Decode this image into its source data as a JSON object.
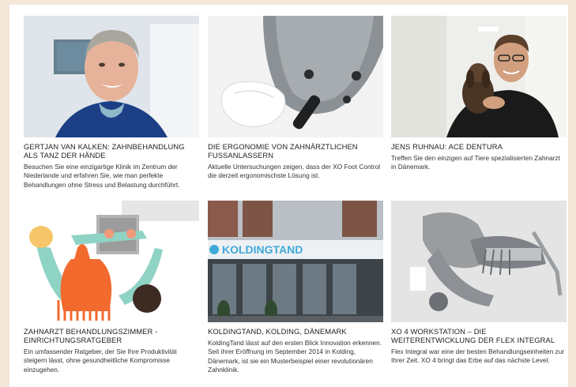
{
  "cards": [
    {
      "title": "GERTJAN VAN KALKEN: ZAHNBEHANDLUNG ALS TANZ DER HÄNDE",
      "desc": "Besuchen Sie eine einzigartige Klinik im Zentrum der Niederlande und erfahren Sie, wie man perfekte Behandlungen ohne Stress und Belastung durchführt.",
      "image": "dentist-portrait-image"
    },
    {
      "title": "DIE ERGONOMIE VON ZAHNÄRZTLICHEN FUSSANLASSERN",
      "desc": "Aktuelle Untersuchungen zeigen, dass der XO Foot Control die derzeit ergonomischste Lösung ist.",
      "image": "foot-control-image"
    },
    {
      "title": "JENS RUHNAU: ACE DENTURA",
      "desc": "Treffen Sie den einzigen auf Tiere spezialisierten Zahnarzt in Dänemark.",
      "image": "dentist-with-dog-image"
    },
    {
      "title": "ZAHNARZT BEHANDLUNGSZIMMER - EINRICHTUNGSRATGEBER",
      "desc": "Ein umfassender Ratgeber, der Sie Ihre Produktivität steigern lässt, ohne gesundheitliche Kompromisse einzugehen.",
      "image": "treatment-room-illustration"
    },
    {
      "title": "KOLDINGTAND, KOLDING, DÄNEMARK",
      "desc": "KoldingTand lässt auf den ersten Blick Innovation erkennen. Seit ihrer Eröffnung im September 2014 in Kolding, Dänemark, ist sie ein Musterbeispiel einer revolutionären Zahnklinik.",
      "image": "clinic-facade-image",
      "sign": "KOLDINGTAND"
    },
    {
      "title": "XO 4 WORKSTATION – DIE WEITERENTWICKLUNG DER FLEX INTEGRAL",
      "desc": "Flex Integral war eine der besten Behandlungseinheiten zur Ihrer Zeit. XO 4 bringt das Erbe auf das nächste Level.",
      "image": "workstation-image"
    }
  ]
}
